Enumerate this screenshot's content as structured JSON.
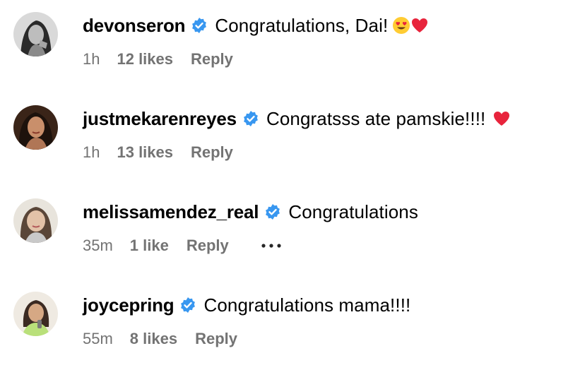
{
  "colors": {
    "text": "#000000",
    "meta": "#737373",
    "verified_badge": "#3897f0"
  },
  "comments": [
    {
      "username": "devonseron",
      "text": "Congratulations, Dai!",
      "emojis": [
        "heart-eyes-emoji",
        "red-heart-emoji"
      ],
      "time": "1h",
      "likes": "12 likes",
      "reply": "Reply"
    },
    {
      "username": "justmekarenreyes",
      "text": "Congratsss ate pamskie!!!!",
      "emojis": [
        "red-heart-emoji"
      ],
      "time": "1h",
      "likes": "13 likes",
      "reply": "Reply"
    },
    {
      "username": "melissamendez_real",
      "text": "Congratulations",
      "emojis": [],
      "time": "35m",
      "likes": "1 like",
      "reply": "Reply",
      "more_icon": "more-options-icon"
    },
    {
      "username": "joycepring",
      "text": "Congratulations mama!!!!",
      "emojis": [],
      "time": "55m",
      "likes": "8 likes",
      "reply": "Reply"
    }
  ]
}
